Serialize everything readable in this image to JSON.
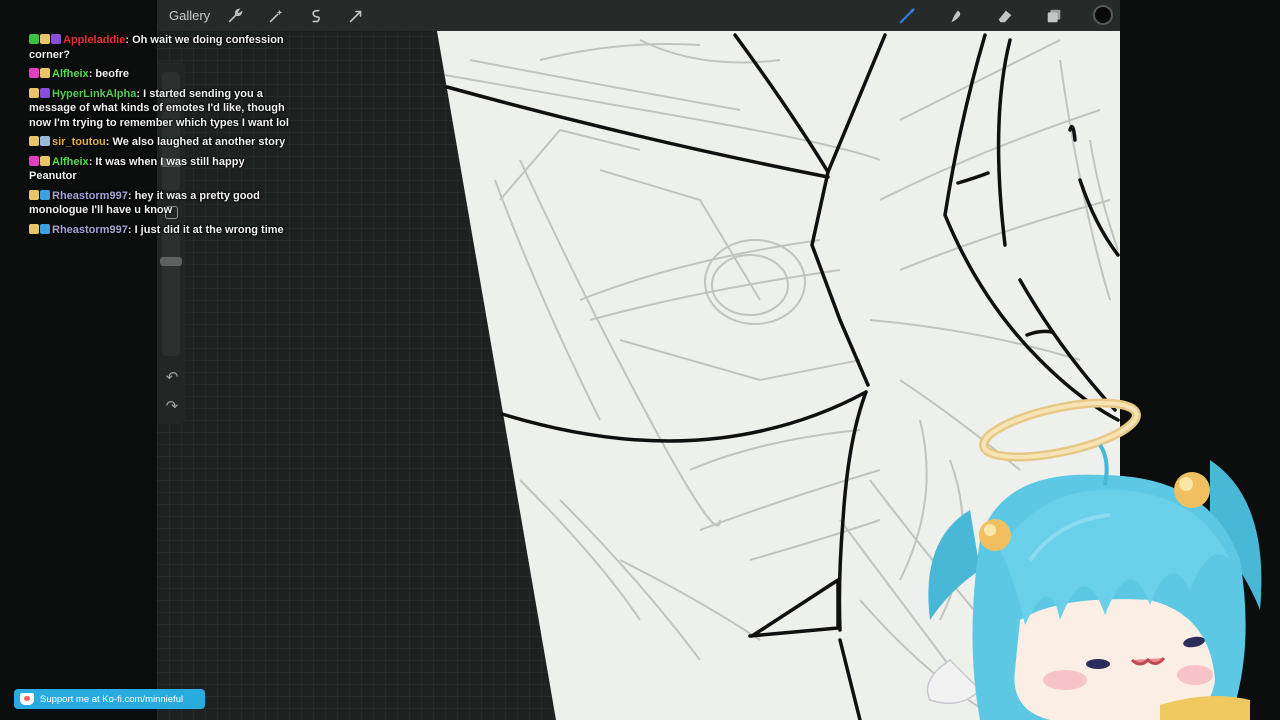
{
  "toolbar": {
    "gallery_label": "Gallery",
    "left_tools": [
      "wrench-icon",
      "magic-wand-icon",
      "selection-icon",
      "transform-icon"
    ],
    "right_tools": [
      "brush-icon",
      "smudge-icon",
      "eraser-icon",
      "layers-icon"
    ],
    "active_tool": "brush",
    "active_color": "#0a0a0a"
  },
  "sidebar": {
    "undo_icon": "undo-icon",
    "redo_icon": "redo-icon"
  },
  "chat": {
    "messages": [
      {
        "user": "Appleladdie",
        "user_color": "#e83030",
        "text": "Oh wait we doing confession corner?"
      },
      {
        "user": "Alfheix",
        "user_color": "#4fe04f",
        "text": "beofre"
      },
      {
        "user": "HyperLinkAlpha",
        "user_color": "#55cc55",
        "text": "I started sending you a message of what kinds of emotes I'd like, though now I'm trying to remember which types I want lol"
      },
      {
        "user": "sir_toutou",
        "user_color": "#e0b040",
        "text": "We also laughed at another story"
      },
      {
        "user": "Alfheix",
        "user_color": "#4fe04f",
        "text": "It was when I was still happy Peanutor"
      },
      {
        "user": "Rheastorm997",
        "user_color": "#a9a4d6",
        "text": "hey it was a pretty good monologue I'll have u know"
      },
      {
        "user": "Rheastorm997",
        "user_color": "#a9a4d6",
        "text": "I just did it at the wrong time"
      }
    ]
  },
  "kofi": {
    "label": "Support me at Ko-fi.com/minnieful",
    "color": "#29abe0"
  }
}
